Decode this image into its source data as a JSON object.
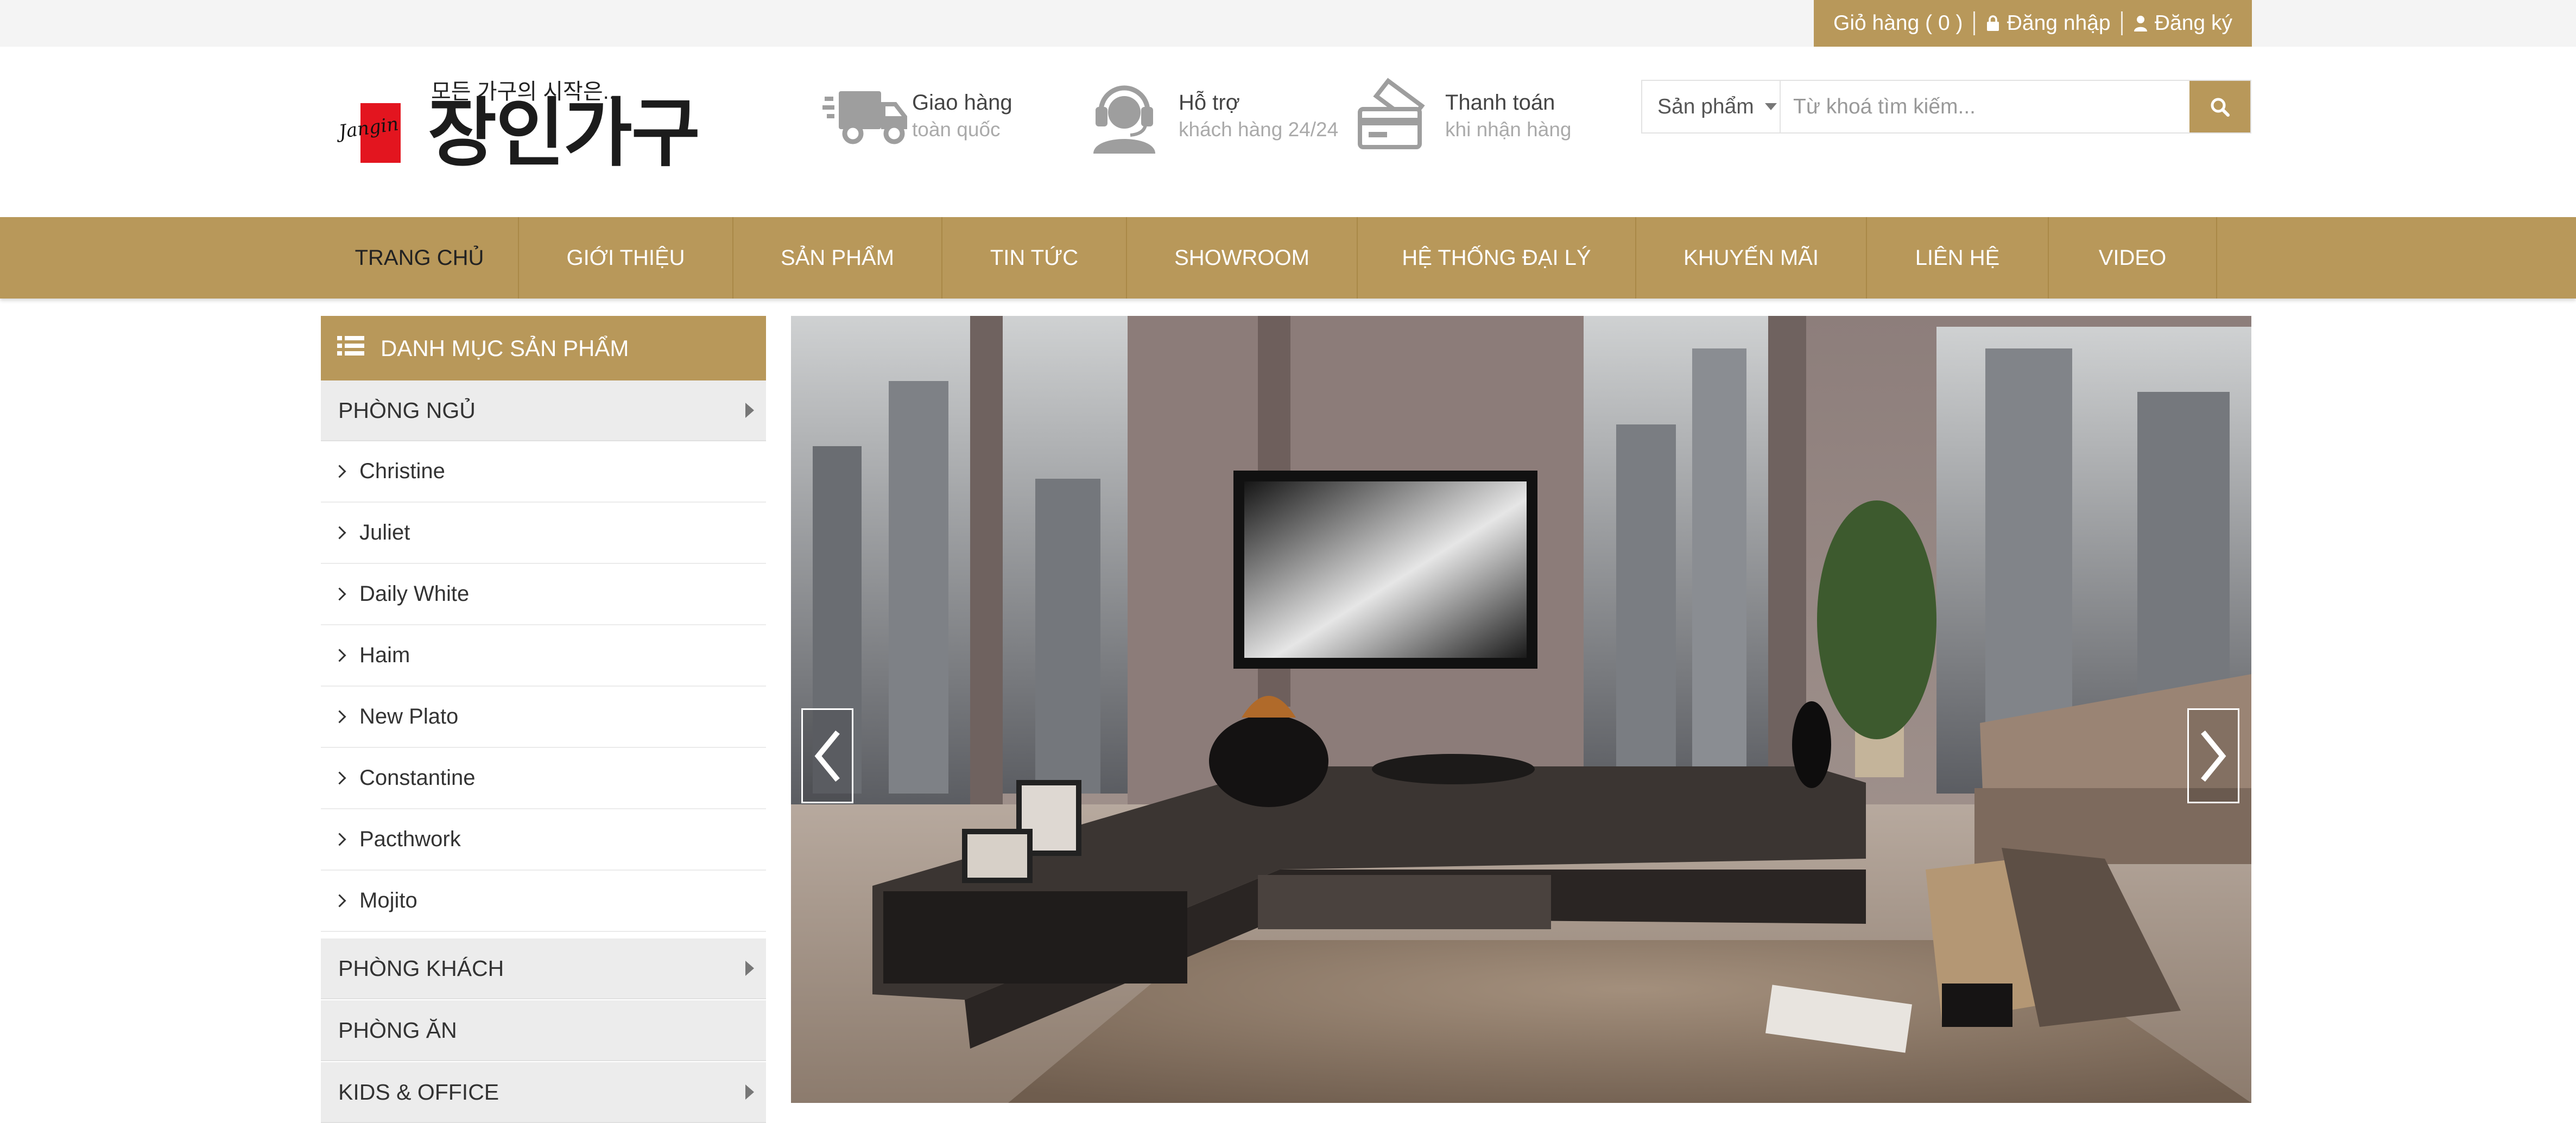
{
  "account_bar": {
    "cart_label": "Giỏ hàng ( 0 )",
    "login_label": "Đăng nhập",
    "register_label": "Đăng ký",
    "bg_color": "#b8985a"
  },
  "logo": {
    "tagline": "모든 가구의 시작은...",
    "script_text": "Jangin",
    "brand_text": "장인가구"
  },
  "features": [
    {
      "icon": "truck-icon",
      "title": "Giao hàng",
      "subtitle": "toàn quốc"
    },
    {
      "icon": "headset-icon",
      "title": "Hỗ trợ",
      "subtitle": "khách hàng 24/24"
    },
    {
      "icon": "payment-card-icon",
      "title": "Thanh toán",
      "subtitle": "khi nhận hàng"
    }
  ],
  "search": {
    "category_selected": "Sản phẩm",
    "placeholder": "Từ khoá tìm kiếm..."
  },
  "nav": {
    "items": [
      {
        "label": "TRANG CHỦ",
        "active": true
      },
      {
        "label": "GIỚI THIỆU"
      },
      {
        "label": "SẢN PHẨM"
      },
      {
        "label": "TIN TỨC"
      },
      {
        "label": "SHOWROOM"
      },
      {
        "label": "HỆ THỐNG ĐẠI LÝ"
      },
      {
        "label": "KHUYẾN MÃI"
      },
      {
        "label": "LIÊN HỆ"
      },
      {
        "label": "VIDEO"
      }
    ]
  },
  "sidebar": {
    "title": "DANH MỤC SẢN PHẨM",
    "categories": [
      {
        "label": "PHÒNG NGỦ",
        "has_children": true
      },
      {
        "label": "PHÒNG KHÁCH",
        "has_children": true
      },
      {
        "label": "PHÒNG ĂN",
        "has_children": false
      },
      {
        "label": "KIDS & OFFICE",
        "has_children": true
      }
    ],
    "subitems": [
      "Christine",
      "Juliet",
      "Daily White",
      "Haim",
      "New Plato",
      "Constantine",
      "Pacthwork",
      "Mojito"
    ]
  },
  "colors": {
    "accent": "#b8985a",
    "topbar_bg": "#f4f4f4",
    "sidebar_row_bg": "#ececec"
  }
}
